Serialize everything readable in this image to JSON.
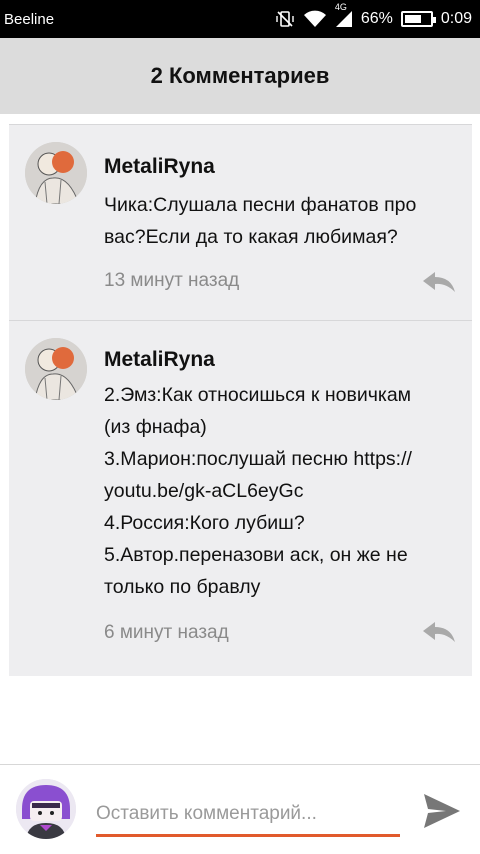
{
  "status_bar": {
    "carrier": "Beeline",
    "network": "4G",
    "battery_percent": "66%",
    "battery_level": 0.66,
    "time": "0:09"
  },
  "header": {
    "title": "2 Комментариев"
  },
  "comments": [
    {
      "username": "MetaliRyna",
      "lines": [
        "Чика:Слушала песни фанатов про",
        "вас?Если да то какая любимая?"
      ],
      "timestamp": "13 минут назад"
    },
    {
      "username": "MetaliRyna",
      "lines": [
        "2.Эмз:Как относишься к новичкам",
        "(из фнафа)",
        "3.Марион:послушай песню https://",
        "youtu.be/gk-aCL6eyGc",
        "4.Россия:Кого лубиш?",
        "5.Автор.переназови аск, он же не",
        "только по бравлу"
      ],
      "timestamp": "6 минут назад"
    }
  ],
  "input_bar": {
    "placeholder": "Оставить комментарий...",
    "value": ""
  },
  "colors": {
    "accent": "#e15a2c",
    "header_bg": "#dcdcdc",
    "card_bg": "#eeeef0"
  },
  "icons": {
    "reply": "reply-arrow-icon",
    "send": "send-icon"
  }
}
